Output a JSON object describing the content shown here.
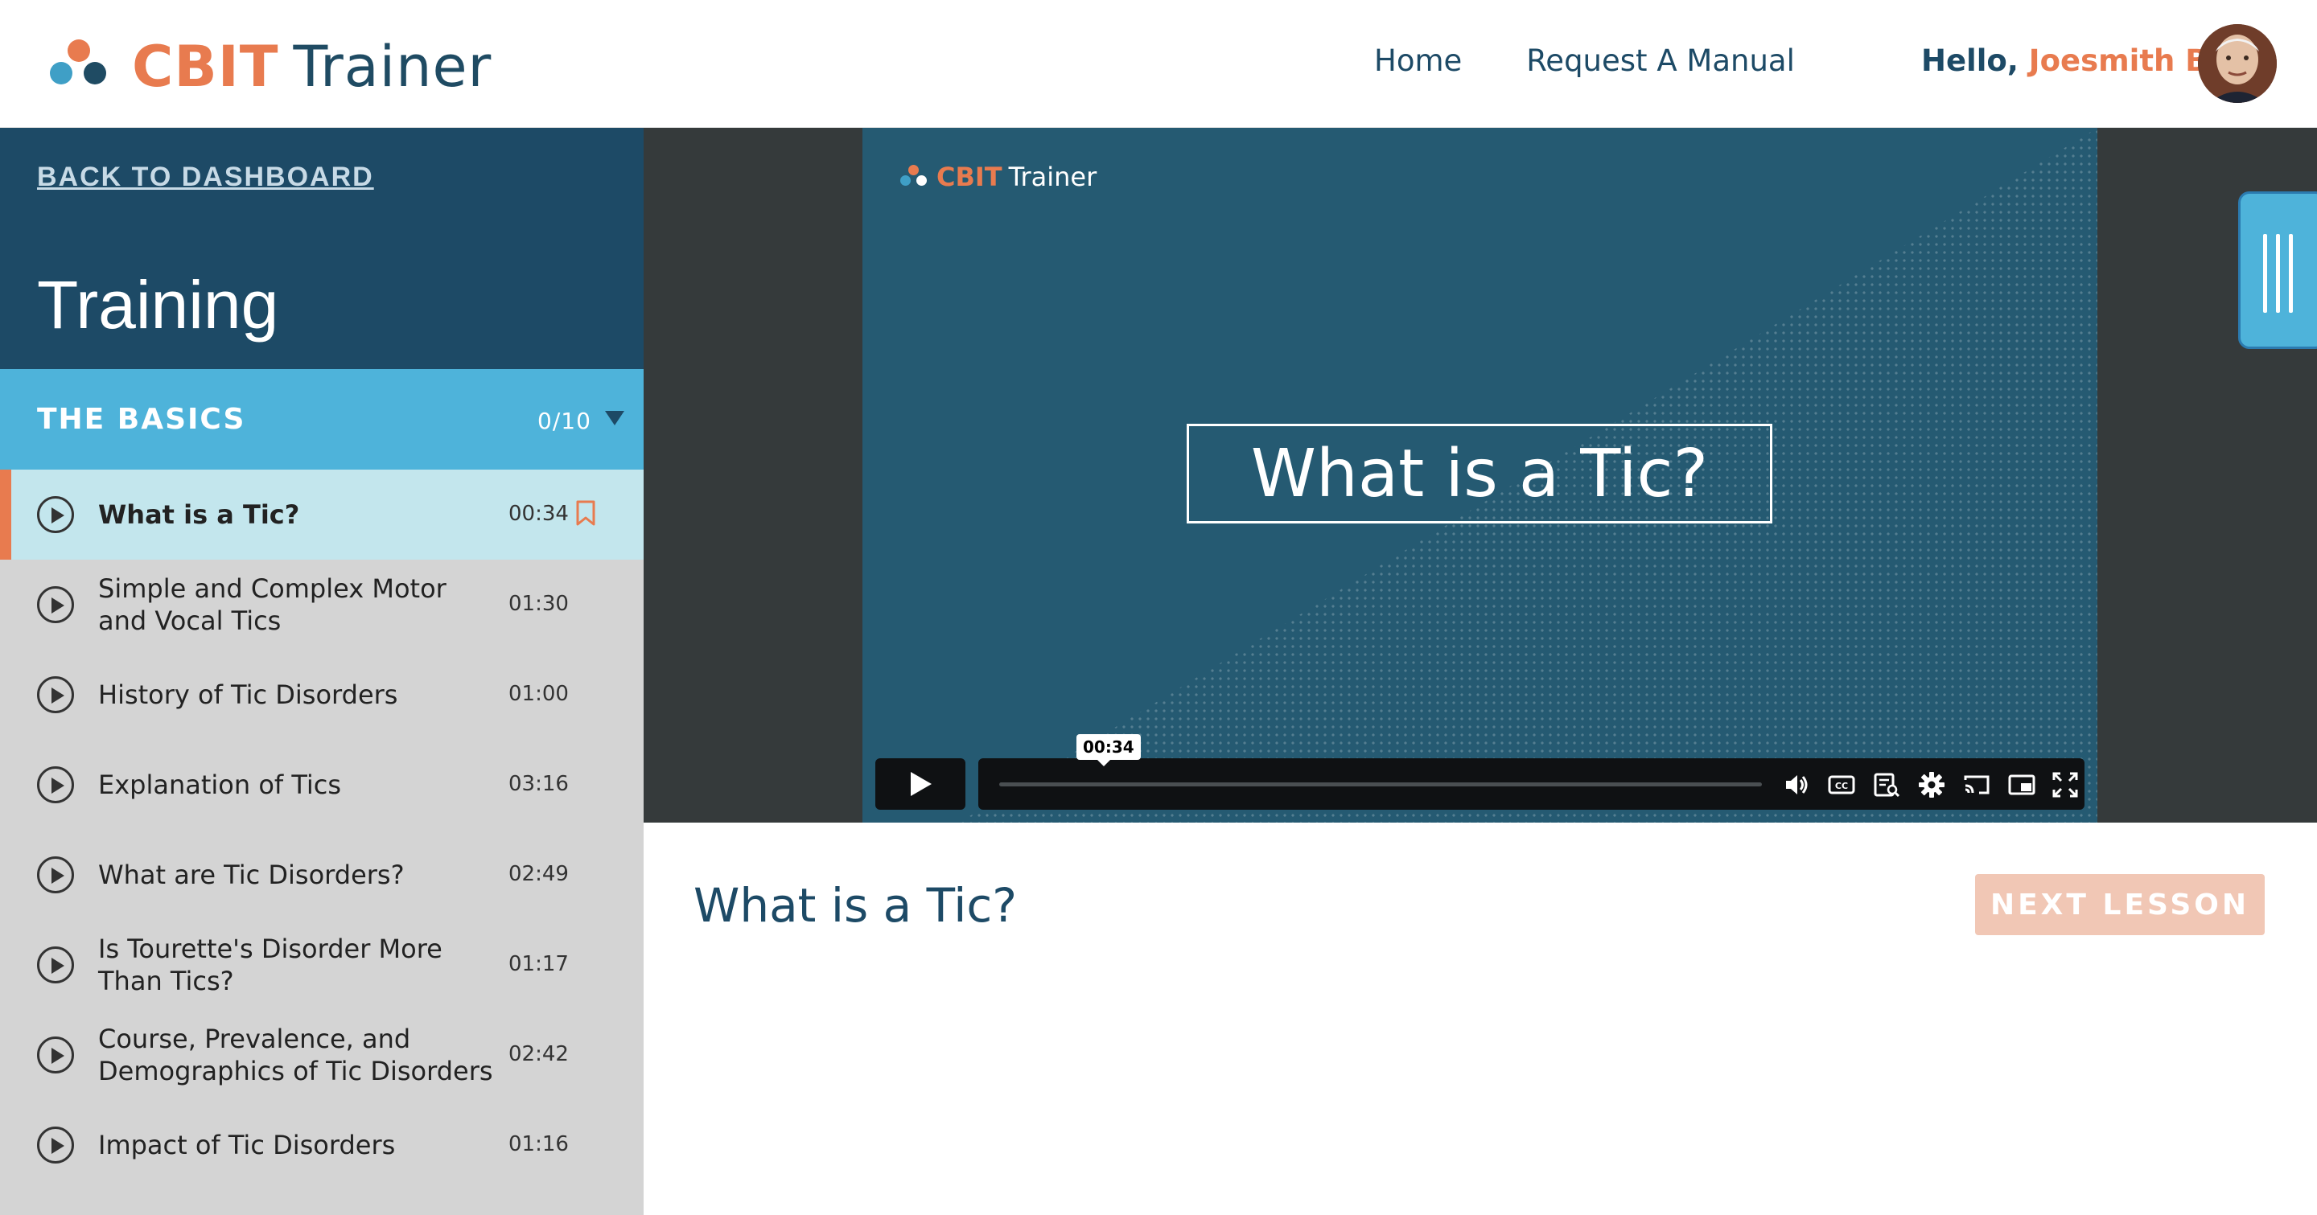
{
  "header": {
    "logo_cbit": "CBIT",
    "logo_trainer": "Trainer",
    "nav": [
      "Home",
      "Request A Manual"
    ],
    "greeting_prefix": "Hello,",
    "user_name": "Joesmith B."
  },
  "sidebar": {
    "back_link": "BACK TO DASHBOARD",
    "title": "Training",
    "section": {
      "name": "THE BASICS",
      "progress": "0/10"
    },
    "lessons": [
      {
        "title": "What is a Tic?",
        "duration": "00:34",
        "active": true
      },
      {
        "title": "Simple and Complex Motor and Vocal Tics",
        "duration": "01:30"
      },
      {
        "title": "History of Tic Disorders",
        "duration": "01:00"
      },
      {
        "title": "Explanation of Tics",
        "duration": "03:16"
      },
      {
        "title": "What are Tic Disorders?",
        "duration": "02:49"
      },
      {
        "title": "Is Tourette's Disorder More Than Tics?",
        "duration": "01:17"
      },
      {
        "title": "Course, Prevalence, and Demographics of Tic Disorders",
        "duration": "02:42"
      },
      {
        "title": "Impact of Tic Disorders",
        "duration": "01:16"
      }
    ]
  },
  "video": {
    "logo_cbit": "CBIT",
    "logo_trainer": "Trainer",
    "slide_title": "What is a Tic?",
    "time_tooltip": "00:34",
    "progress": 0
  },
  "content": {
    "title": "What is a Tic?",
    "next_button": "NEXT LESSON"
  },
  "colors": {
    "accent_orange": "#e87b4f",
    "navy": "#1d4a66",
    "section_blue": "#4eb3da",
    "active_row": "#c3e6ed"
  },
  "icons": [
    "play-icon",
    "volume-icon",
    "captions-icon",
    "transcript-icon",
    "settings-icon",
    "cast-icon",
    "pip-icon",
    "fullscreen-icon",
    "bookmark-icon"
  ]
}
